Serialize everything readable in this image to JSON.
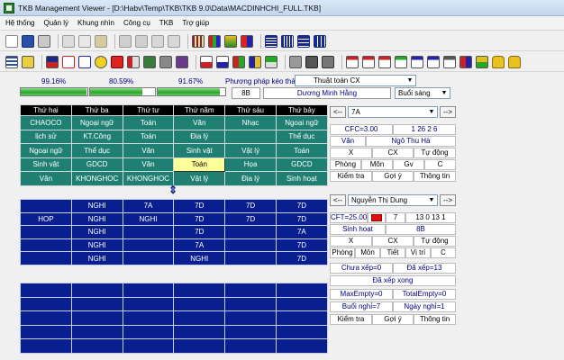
{
  "window": {
    "title": "TKB Management Viewer - [D:\\Habv\\Temp\\TKB\\TKB 9.0\\Data\\MACDINHCHI_FULL.TKB]"
  },
  "menu": [
    "Hệ thống",
    "Quản lý",
    "Khung nhìn",
    "Công cụ",
    "TKB",
    "Trợ giúp"
  ],
  "status": {
    "progress": [
      {
        "label": "99.16%",
        "value": 99.16
      },
      {
        "label": "80.59%",
        "value": 80.59
      },
      {
        "label": "91.67%",
        "value": 91.67
      }
    ],
    "method_label": "Phương pháp kéo thả:",
    "method_value": "Thuật toán CX",
    "class_value": "8B",
    "teacher_value": "Dương Minh Hằng",
    "session_value": "Buổi sáng"
  },
  "top_grid": {
    "headers": [
      "Thứ hai",
      "Thứ ba",
      "Thứ tư",
      "Thứ năm",
      "Thứ sáu",
      "Thứ bảy"
    ],
    "rows": [
      [
        "CHAOCO",
        "Ngoại ngữ",
        "Toán",
        "Văn",
        "Nhạc",
        "Ngoại ngữ"
      ],
      [
        "lịch sử",
        "KT.Công",
        "Toán",
        "Địa lý",
        "",
        "Thể dục"
      ],
      [
        "Ngoại ngữ",
        "Thể dục",
        "Văn",
        "Sinh vật",
        "Vật lý",
        "Toán"
      ],
      [
        "Sinh vật",
        "GDCD",
        "Văn",
        "Toán",
        "Họa",
        "GDCD"
      ],
      [
        "Văn",
        "KHONGHOC",
        "KHONGHOC",
        "Vật lý",
        "Địa lý",
        "Sinh hoạt"
      ]
    ]
  },
  "mid_grid": {
    "rows": [
      [
        "",
        "NGHI",
        "7A",
        "7D",
        "7D",
        "7D"
      ],
      [
        "HOP",
        "NGHI",
        "NGHI",
        "7D",
        "7D",
        "7D"
      ],
      [
        "",
        "NGHI",
        "",
        "7D",
        "",
        "7A"
      ],
      [
        "",
        "NGHI",
        "",
        "7A",
        "",
        "7D"
      ],
      [
        "",
        "NGHI",
        "",
        "NGHI",
        "",
        "7D"
      ]
    ]
  },
  "bot_grid": {
    "rows": [
      [
        "",
        "",
        "",
        "",
        "",
        ""
      ],
      [
        "",
        "",
        "",
        "",
        "",
        ""
      ],
      [
        "",
        "",
        "",
        "",
        "",
        ""
      ],
      [
        "",
        "",
        "",
        "",
        "",
        ""
      ],
      [
        "",
        "",
        "",
        "",
        "",
        ""
      ]
    ]
  },
  "class_panel": {
    "prev": "<--",
    "next": "-->",
    "selected": "7A",
    "cfc": "CFC=3.00",
    "numbers": "1 26 2 6",
    "subject": "Văn",
    "teacher": "Ngô Thu Hà",
    "row1": [
      "X",
      "CX",
      "Tự động"
    ],
    "row2": [
      "Phòng",
      "Môn",
      "Gv",
      "C"
    ],
    "row3": [
      "Kiểm tra",
      "Gợi ý",
      "Thông tin"
    ]
  },
  "teacher_panel": {
    "prev": "<--",
    "next": "-->",
    "selected": "Nguyễn Thị Dung",
    "cft": "CFT=25.00",
    "count": "7",
    "numbers": "13 0 13 1",
    "subject": "Sinh hoạt",
    "class": "8B",
    "row1": [
      "X",
      "CX",
      "Tự động"
    ],
    "row2": [
      "Phòng",
      "Môn",
      "Tiết",
      "Vị trí",
      "C"
    ],
    "unscheduled": "Chưa xếp=0",
    "scheduled": "Đã xếp=13",
    "done": "Đã xếp xong",
    "max_empty": "MaxEmpty=0",
    "total_empty": "TotalEmpty=0",
    "sessions_off": "Buổi nghỉ=7",
    "days_off": "Ngày nghỉ=1",
    "row3": [
      "Kiểm tra",
      "Gợi ý",
      "Thông tin"
    ]
  }
}
